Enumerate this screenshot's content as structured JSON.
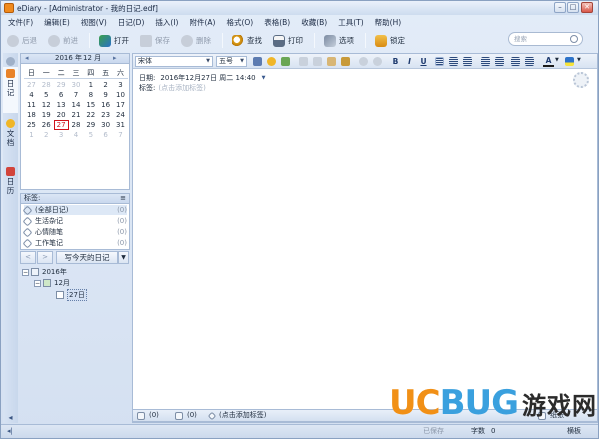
{
  "window": {
    "title": "eDiary - [Administrator - 我的日记.edf]",
    "controls": {
      "minimize": "–",
      "maximize": "□",
      "close": "✕"
    }
  },
  "menu": [
    "文件(F)",
    "编辑(E)",
    "视图(V)",
    "日记(D)",
    "插入(I)",
    "附件(A)",
    "格式(O)",
    "表格(B)",
    "收藏(B)",
    "工具(T)",
    "帮助(H)"
  ],
  "toolbar": {
    "back": "后退",
    "forward": "前进",
    "open": "打开",
    "save": "保存",
    "delete": "删除",
    "find": "查找",
    "print": "打印",
    "options": "选项",
    "lock": "锁定"
  },
  "search": {
    "placeholder": "搜索"
  },
  "left_tabs": [
    "日记",
    "文档",
    "日历"
  ],
  "calendar": {
    "year_label": "2016 年",
    "month_label": "12 月",
    "weekdays": [
      "日",
      "一",
      "二",
      "三",
      "四",
      "五",
      "六"
    ],
    "days": [
      [
        "27",
        "28",
        "29",
        "30",
        "1",
        "2",
        "3"
      ],
      [
        "4",
        "5",
        "6",
        "7",
        "8",
        "9",
        "10"
      ],
      [
        "11",
        "12",
        "13",
        "14",
        "15",
        "16",
        "17"
      ],
      [
        "18",
        "19",
        "20",
        "21",
        "22",
        "23",
        "24"
      ],
      [
        "25",
        "26",
        "27",
        "28",
        "29",
        "30",
        "31"
      ],
      [
        "1",
        "2",
        "3",
        "4",
        "5",
        "6",
        "7"
      ]
    ],
    "today": "27"
  },
  "tags": {
    "header": "标签:",
    "items": [
      {
        "label": "(全部日记)",
        "count": "(0)"
      },
      {
        "label": "生活杂记",
        "count": "(0)"
      },
      {
        "label": "心情随笔",
        "count": "(0)"
      },
      {
        "label": "工作笔记",
        "count": "(0)"
      }
    ]
  },
  "nav": {
    "prev": "<",
    "next": ">",
    "today_button": "写今天的日记",
    "dropdown": "▼"
  },
  "tree": {
    "year": "2016年",
    "month": "12月",
    "day": "27日",
    "expand": "−"
  },
  "format": {
    "font": "宋体",
    "size": "五号",
    "bold": "B",
    "italic": "I",
    "underline": "U",
    "font_color": "A"
  },
  "entry": {
    "date_label": "日期:",
    "date_value": "2016年12月27日  周二  14:40",
    "tag_label": "标签:",
    "tag_placeholder": "(点击添加标签)"
  },
  "status": {
    "attachments": "(0)",
    "comments": "(0)",
    "tag_hint": "(点击添加标签)"
  },
  "bottom": {
    "saved": "已保存",
    "word_count_label": "字数",
    "word_count": "0",
    "paper": "纸张",
    "landscape": "横板"
  },
  "watermark": {
    "latin": "UCBUG",
    "chinese": "游戏网"
  }
}
